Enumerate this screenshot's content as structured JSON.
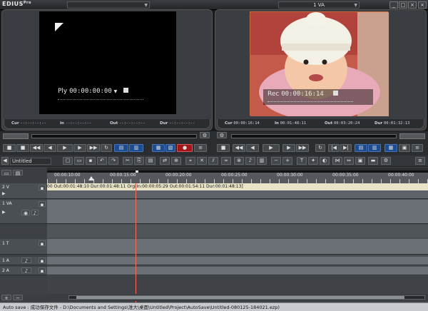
{
  "app": {
    "logo": "EDIUS",
    "logo_suffix": "Pro"
  },
  "window_buttons": [
    "_",
    "□",
    "×",
    "×"
  ],
  "player": {
    "dropdown_value": "",
    "timecode_label": "Ply",
    "timecode": "00:00:00:00",
    "cur_label": "Cur",
    "cur_value": "--:--:--:--",
    "in_label": "In",
    "in_value": "--:--:--:--",
    "out_label": "Out",
    "out_value": "--:--:--:--",
    "dur_label": "Dur",
    "dur_value": "--:--:--:--"
  },
  "recorder": {
    "dropdown_value": "1 VA",
    "timecode_label": "Rec",
    "timecode": "00:00:16:14",
    "cur_label": "Cur",
    "cur_value": "00:00:16:14",
    "in_label": "In",
    "in_value": "00:01:48:11",
    "out_label": "Out",
    "out_value": "00:03:20:24",
    "dur_label": "Dur",
    "dur_value": "00:01:32:13"
  },
  "timeline": {
    "sequence_name": "Untitled",
    "ruler_labels": [
      "00:00:10:00",
      "00:00:15:00",
      "00:00:20:00",
      "00:00:25:00",
      "00:00:30:00",
      "00:00:35:00",
      "00:00:40:00"
    ],
    "clip_text": "00 Out:00:01:48:10 Dur:00:01:48:11 Org[In:00:00:05:29 Out:00:01:54:11 Dur:00:01:48:13]",
    "tracks": [
      {
        "label": "2 V"
      },
      {
        "label": "1 VA"
      },
      {
        "label": "1 T"
      },
      {
        "label": "1 A"
      },
      {
        "label": "2 A"
      }
    ]
  },
  "status_bar": {
    "text": "Auto save : 成功保存文件 - D:\\Documents and Settings\\淮大\\桌面\\Untitled\\Project\\AutoSave\\Untitled-080125-184021.ezp)"
  },
  "colors": {
    "accent_blue": "#1c4c92",
    "accent_red": "#a2161a",
    "playhead": "#ff6b5a"
  }
}
